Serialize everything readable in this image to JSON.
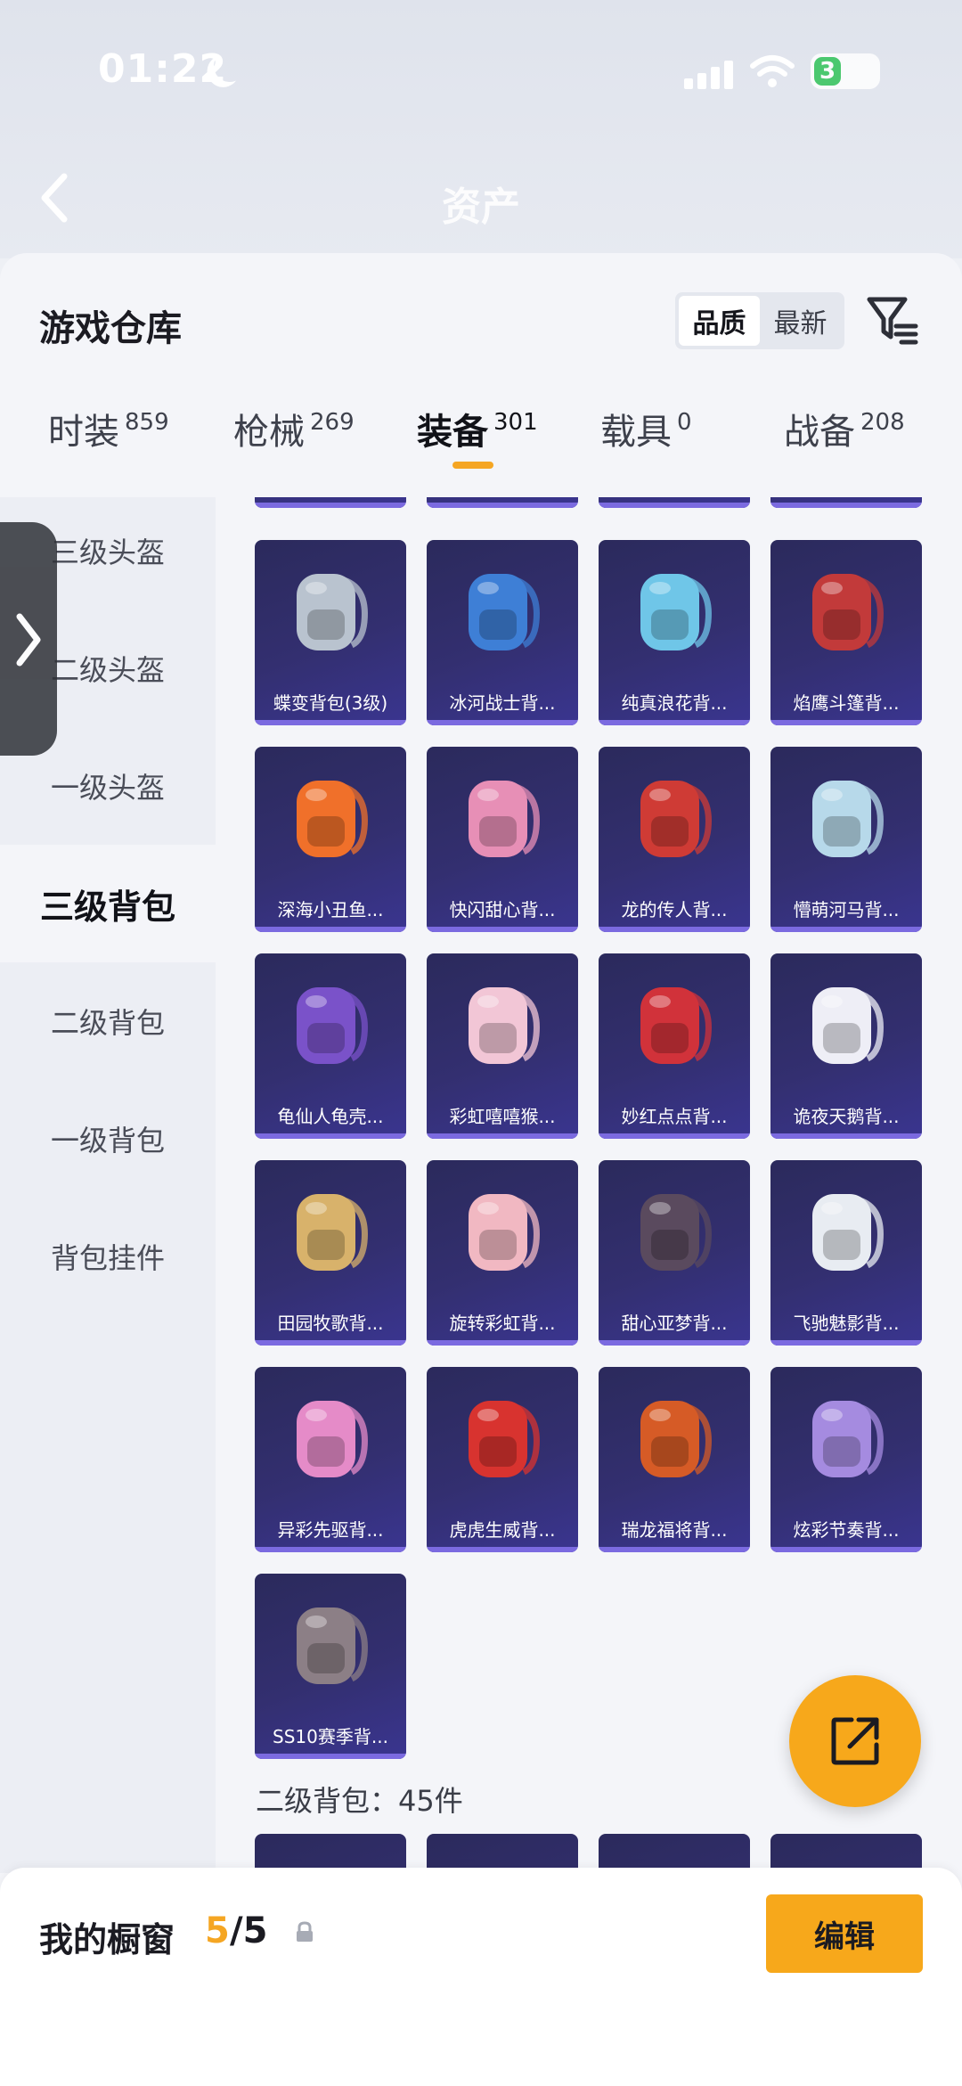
{
  "status_bar": {
    "time": "01:22",
    "battery": "3"
  },
  "header": {
    "title": "资产"
  },
  "panel": {
    "title": "游戏仓库",
    "sort_options": [
      "品质",
      "最新"
    ],
    "active_sort": "品质"
  },
  "tabs": [
    {
      "label": "时装",
      "count": "859"
    },
    {
      "label": "枪械",
      "count": "269"
    },
    {
      "label": "装备",
      "count": "301",
      "active": true
    },
    {
      "label": "载具",
      "count": "0"
    },
    {
      "label": "战备",
      "count": "208"
    }
  ],
  "sidebar": {
    "items": [
      "三级头盔",
      "二级头盔",
      "一级头盔",
      "三级背包",
      "二级背包",
      "一级背包",
      "背包挂件"
    ],
    "active": "三级背包"
  },
  "items": [
    {
      "label": "蝶变背包(3级)",
      "color": "#b9c3cf"
    },
    {
      "label": "冰河战士背...",
      "color": "#3e7fd6"
    },
    {
      "label": "纯真浪花背...",
      "color": "#6fc6e8"
    },
    {
      "label": "焰鹰斗篷背...",
      "color": "#c23a3a"
    },
    {
      "label": "深海小丑鱼...",
      "color": "#f0702a"
    },
    {
      "label": "快闪甜心背...",
      "color": "#e78fb6"
    },
    {
      "label": "龙的传人背...",
      "color": "#cf3b35"
    },
    {
      "label": "懵萌河马背...",
      "color": "#b7d9ea"
    },
    {
      "label": "龟仙人龟壳...",
      "color": "#7a52c9"
    },
    {
      "label": "彩虹嘻嘻猴...",
      "color": "#f2c6d6"
    },
    {
      "label": "妙红点点背...",
      "color": "#d1323a"
    },
    {
      "label": "诡夜天鹅背...",
      "color": "#eeeef6"
    },
    {
      "label": "田园牧歌背...",
      "color": "#d8b26b"
    },
    {
      "label": "旋转彩虹背...",
      "color": "#f1b8c2"
    },
    {
      "label": "甜心亚梦背...",
      "color": "#5a4a5e"
    },
    {
      "label": "飞驰魅影背...",
      "color": "#e8ecf2"
    },
    {
      "label": "异彩先驱背...",
      "color": "#e58bc8"
    },
    {
      "label": "虎虎生威背...",
      "color": "#d8332f"
    },
    {
      "label": "瑞龙福将背...",
      "color": "#d65b26"
    },
    {
      "label": "炫彩节奏背...",
      "color": "#a58be0"
    },
    {
      "label": "SS10赛季背...",
      "color": "#8c7f86"
    }
  ],
  "section_label": "二级背包：45件",
  "showcase": {
    "label": "我的橱窗",
    "count": "5",
    "total": "/5"
  },
  "edit_button": "编辑"
}
